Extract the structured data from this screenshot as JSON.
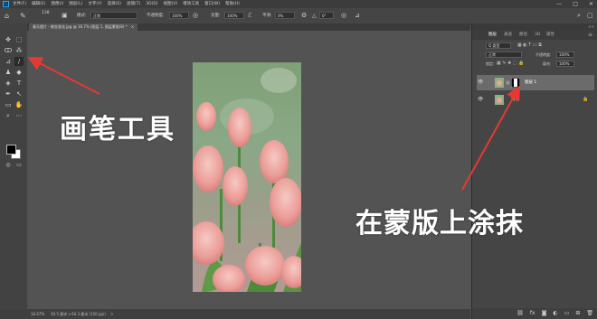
{
  "app": {
    "logo": "Ps",
    "menus": [
      "文件(F)",
      "编辑(E)",
      "图像(I)",
      "图层(L)",
      "文字(Y)",
      "选择(S)",
      "滤镜(T)",
      "3D(D)",
      "视图(V)",
      "增效工具",
      "窗口(W)",
      "帮助(H)"
    ],
    "window_controls": [
      "—",
      "□",
      "✕"
    ]
  },
  "options": {
    "brush_size": "138",
    "mode_label": "模式:",
    "mode_value": "正常",
    "opacity_label": "不透明度:",
    "opacity_value": "100%",
    "flow_label": "流量:",
    "flow_value": "100%",
    "smooth_label": "平滑:",
    "smooth_value": "0%",
    "angle_value": "0°"
  },
  "document": {
    "tab_label": "春天图片 - 郁金香花.jpg @ 16.7% (图层 1, 图层蒙版/8) *",
    "tab_close": "×"
  },
  "status": {
    "zoom": "16.67%",
    "doc_info": "30.5 厘米 x 64.3 厘米 (150 ppi)",
    "arrow": ">"
  },
  "panel": {
    "collapse_label": "<<",
    "tabs": [
      "图层",
      "通道",
      "路径",
      "3D",
      "属性"
    ],
    "active_tab": 0,
    "filter_label": "Q 类型",
    "blend_mode": "正常",
    "opacity_label": "不透明度:",
    "opacity_value": "100%",
    "lock_label": "锁定:",
    "fill_label": "填充:",
    "fill_value": "100%",
    "layers": [
      {
        "name": "图层 1",
        "selected": true,
        "has_mask": true
      },
      {
        "name": "背景",
        "selected": false,
        "has_mask": false,
        "locked": true
      }
    ],
    "bottom_icons": [
      "link-icon",
      "fx-icon",
      "mask-icon",
      "adjustment-icon",
      "group-icon",
      "new-layer-icon",
      "trash-icon"
    ]
  },
  "annotations": {
    "brush_tool": "画笔工具",
    "paint_on_mask": "在蒙版上涂抹"
  },
  "colors": {
    "annotation_arrow": "#e53935",
    "foreground": "#000000",
    "background": "#ffffff"
  }
}
